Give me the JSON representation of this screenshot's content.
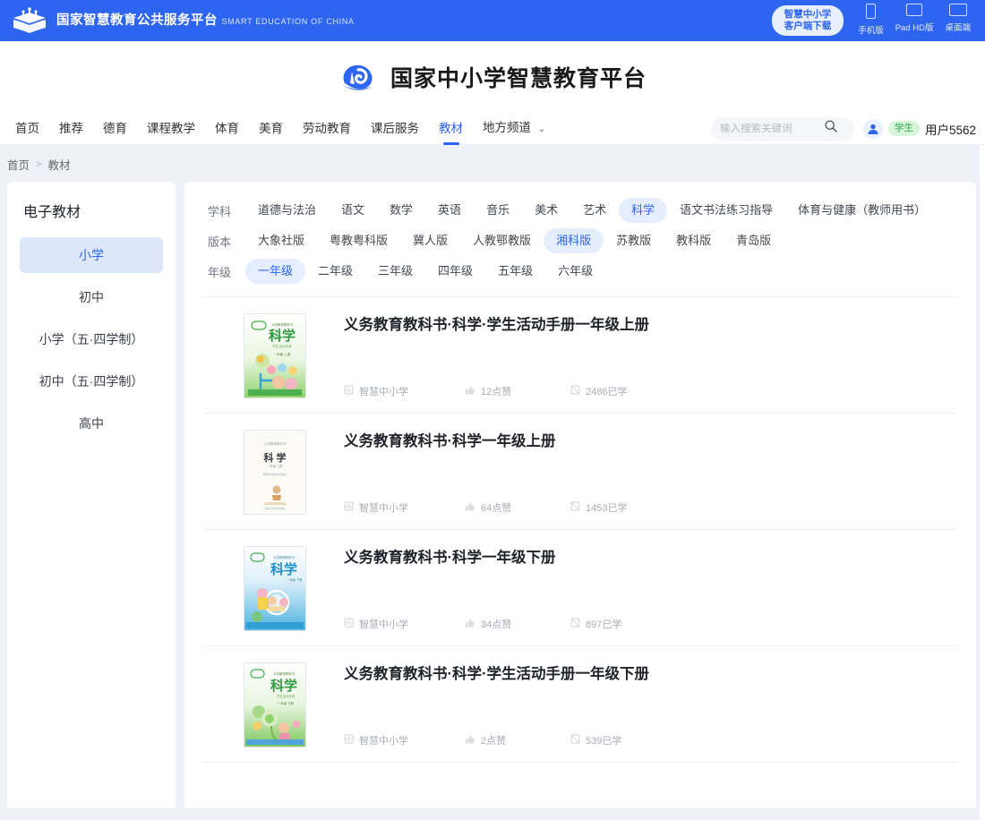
{
  "topbar": {
    "logo_zh": "国家智慧教育公共服务平台",
    "logo_en": "SMART EDUCATION OF CHINA",
    "download_line1": "智慧中小学",
    "download_line2": "客户端下载",
    "devices": [
      {
        "icon": "phone-icon",
        "label": "手机版"
      },
      {
        "icon": "tablet-icon",
        "label": "Pad HD版"
      },
      {
        "icon": "desktop-icon",
        "label": "桌面端"
      }
    ],
    "accent": "#2d64f0"
  },
  "brand": {
    "title": "国家中小学智慧教育平台",
    "logo_icon": "cloud-swan-logo"
  },
  "nav": {
    "items": [
      {
        "label": "首页",
        "active": false
      },
      {
        "label": "推荐",
        "active": false
      },
      {
        "label": "德育",
        "active": false
      },
      {
        "label": "课程教学",
        "active": false
      },
      {
        "label": "体育",
        "active": false
      },
      {
        "label": "美育",
        "active": false
      },
      {
        "label": "劳动教育",
        "active": false
      },
      {
        "label": "课后服务",
        "active": false
      },
      {
        "label": "教材",
        "active": true
      },
      {
        "label": "地方频道",
        "active": false,
        "has_dropdown": true
      }
    ],
    "dropdown_glyph": "⌄"
  },
  "search": {
    "placeholder": "输入搜索关键词",
    "value": "",
    "icon": "search-icon"
  },
  "user": {
    "role_badge": "学生",
    "name": "用户5562",
    "avatar_icon": "user-avatar-icon"
  },
  "breadcrumb": {
    "home": "首页",
    "separator": ">",
    "current": "教材"
  },
  "sidebar": {
    "title": "电子教材",
    "items": [
      {
        "label": "小学",
        "active": true
      },
      {
        "label": "初中",
        "active": false
      },
      {
        "label": "小学（五·四学制）",
        "active": false
      },
      {
        "label": "初中（五·四学制）",
        "active": false
      },
      {
        "label": "高中",
        "active": false
      }
    ]
  },
  "filters": [
    {
      "label": "学科",
      "options": [
        {
          "label": "道德与法治",
          "active": false
        },
        {
          "label": "语文",
          "active": false
        },
        {
          "label": "数学",
          "active": false
        },
        {
          "label": "英语",
          "active": false
        },
        {
          "label": "音乐",
          "active": false
        },
        {
          "label": "美术",
          "active": false
        },
        {
          "label": "艺术",
          "active": false
        },
        {
          "label": "科学",
          "active": true
        },
        {
          "label": "语文书法练习指导",
          "active": false
        },
        {
          "label": "体育与健康（教师用书）",
          "active": false
        }
      ]
    },
    {
      "label": "版本",
      "options": [
        {
          "label": "大象社版",
          "active": false
        },
        {
          "label": "粤教粤科版",
          "active": false
        },
        {
          "label": "冀人版",
          "active": false
        },
        {
          "label": "人教鄂教版",
          "active": false
        },
        {
          "label": "湘科版",
          "active": true
        },
        {
          "label": "苏教版",
          "active": false
        },
        {
          "label": "教科版",
          "active": false
        },
        {
          "label": "青岛版",
          "active": false
        }
      ]
    },
    {
      "label": "年级",
      "options": [
        {
          "label": "一年级",
          "active": true
        },
        {
          "label": "二年级",
          "active": false
        },
        {
          "label": "三年级",
          "active": false
        },
        {
          "label": "四年级",
          "active": false
        },
        {
          "label": "五年级",
          "active": false
        },
        {
          "label": "六年级",
          "active": false
        }
      ]
    }
  ],
  "books": [
    {
      "title": "义务教育教科书·科学·学生活动手册一年级上册",
      "source": "智慧中小学",
      "likes": "12点赞",
      "studied": "2486已学",
      "cover_style": "green-gradient",
      "cover_title": "科学"
    },
    {
      "title": "义务教育教科书·科学一年级上册",
      "source": "智慧中小学",
      "likes": "64点赞",
      "studied": "1453已学",
      "cover_style": "plain-white",
      "cover_title": "科学"
    },
    {
      "title": "义务教育教科书·科学一年级下册",
      "source": "智慧中小学",
      "likes": "34点赞",
      "studied": "897已学",
      "cover_style": "blue-gradient",
      "cover_title": "科学"
    },
    {
      "title": "义务教育教科书·科学·学生活动手册一年级下册",
      "source": "智慧中小学",
      "likes": "2点赞",
      "studied": "539已学",
      "cover_style": "green-gradient",
      "cover_title": "科学"
    }
  ],
  "icons": {
    "source": "source-icon",
    "like": "thumbs-up-icon",
    "studied": "book-study-icon"
  }
}
